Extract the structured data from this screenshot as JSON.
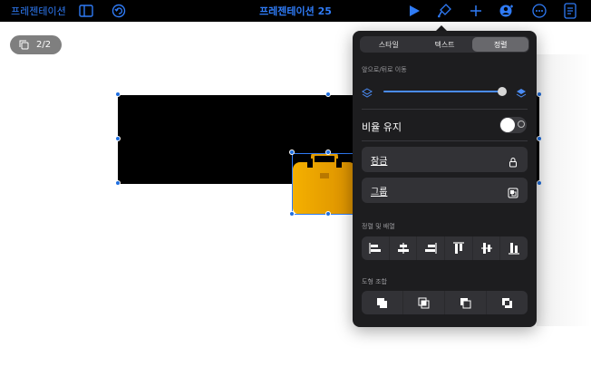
{
  "topbar": {
    "presentations_link": "프레젠테이션",
    "doc_title": "프레젠테이션 25"
  },
  "canvas": {
    "page_counter": "2/2"
  },
  "panel": {
    "tabs": [
      {
        "label": "스타일",
        "active": false
      },
      {
        "label": "텍스트",
        "active": false
      },
      {
        "label": "정렬",
        "active": true
      }
    ],
    "move_section_label": "앞으로/뒤로 이동",
    "move_slider_value": 1.0,
    "keep_ratio_label": "비율 유지",
    "keep_ratio_on": false,
    "lock_label": "잠금",
    "group_label": "그룹",
    "align_section_label": "정렬 및 배열",
    "shape_combine_label": "도형 조합"
  },
  "colors": {
    "accent": "#2f7bf6",
    "panel_bg": "#1d1d1f",
    "briefcase": "#f2a500"
  }
}
